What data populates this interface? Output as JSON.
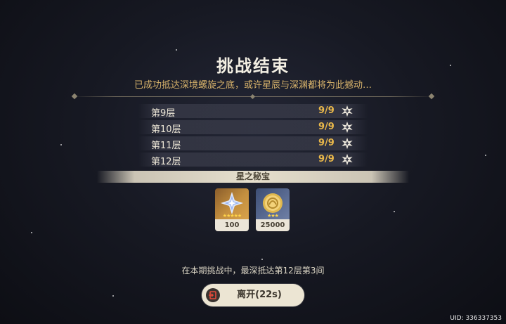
{
  "header": {
    "title": "挑战结束",
    "subtitle": "已成功抵达深境螺旋之底，或许星辰与深渊都将为此撼动…"
  },
  "floors": [
    {
      "name": "第9层",
      "score": "9/9"
    },
    {
      "name": "第10层",
      "score": "9/9"
    },
    {
      "name": "第11层",
      "score": "9/9"
    },
    {
      "name": "第12层",
      "score": "9/9"
    }
  ],
  "rewards_section": {
    "title": "星之秘宝",
    "items": [
      {
        "icon": "primogem-icon",
        "rarity": 5,
        "count": "100"
      },
      {
        "icon": "mora-coin-icon",
        "rarity": 3,
        "count": "25000"
      }
    ]
  },
  "status_text": "在本期挑战中，最深抵达第12层第3间",
  "leave_button": {
    "label": "离开(22s)",
    "icon": "exit-icon"
  },
  "uid": "UID: 336337353",
  "colors": {
    "accent_gold": "#e8b74a",
    "subtitle_gold": "#d8b36b",
    "button_bg": "#ece5d3"
  }
}
